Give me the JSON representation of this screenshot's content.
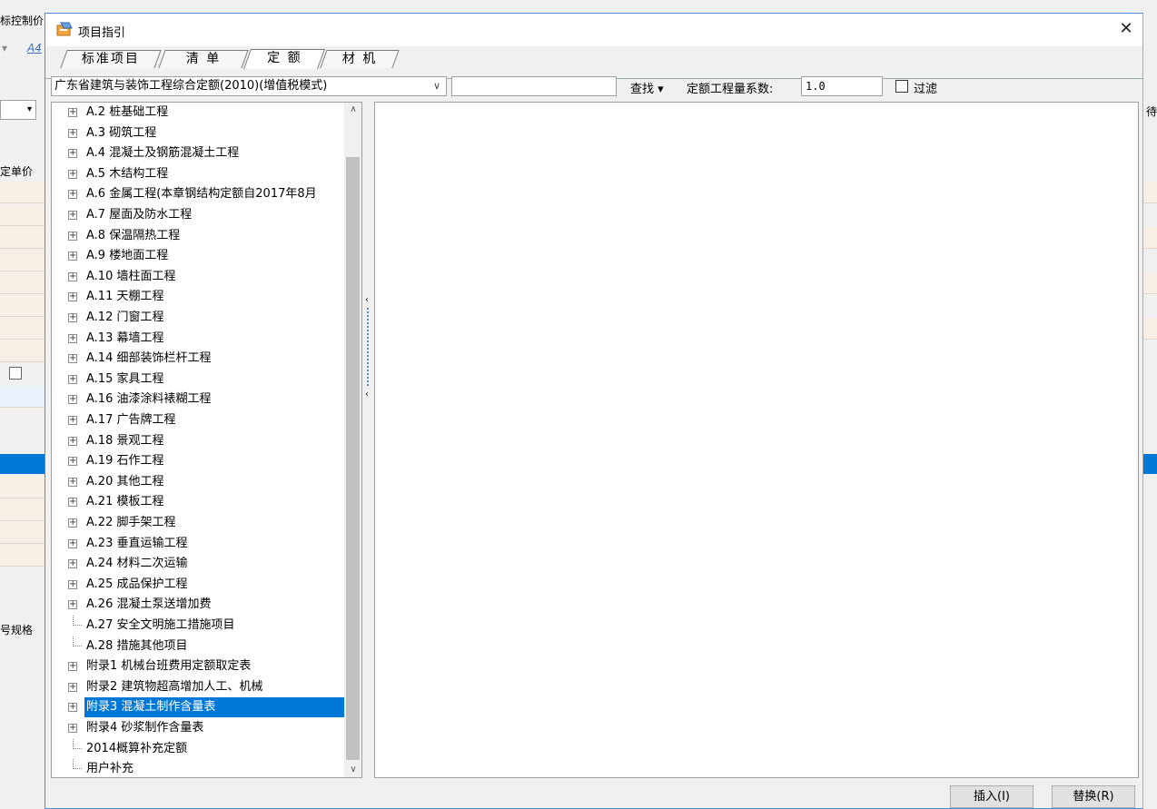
{
  "background": {
    "top_label": "标控制价",
    "price_header": "定单价",
    "spec_header": "号规格",
    "right_label": "待征",
    "font_icon": "A4"
  },
  "dialog": {
    "title": "项目指引",
    "close_label": "✕",
    "tabs": [
      {
        "label": "标准项目"
      },
      {
        "label": "清 单"
      },
      {
        "label": "定 额"
      },
      {
        "label": "材 机"
      }
    ],
    "quota_select": "广东省建筑与装饰工程综合定额(2010)(增值税模式)",
    "search_value": "",
    "find_label": "查找 ▾",
    "coef_label": "定额工程量系数:",
    "coef_value": "1.0",
    "filter_label": "过滤",
    "insert_label": "插入(I)",
    "replace_label": "替换(R)"
  },
  "tree": [
    {
      "label": "A.2 桩基础工程",
      "expandable": true
    },
    {
      "label": "A.3 砌筑工程",
      "expandable": true
    },
    {
      "label": "A.4 混凝土及钢筋混凝土工程",
      "expandable": true
    },
    {
      "label": "A.5 木结构工程",
      "expandable": true
    },
    {
      "label": "A.6 金属工程(本章钢结构定额自2017年8月",
      "expandable": true
    },
    {
      "label": "A.7 屋面及防水工程",
      "expandable": true
    },
    {
      "label": "A.8 保温隔热工程",
      "expandable": true
    },
    {
      "label": "A.9 楼地面工程",
      "expandable": true
    },
    {
      "label": "A.10 墙柱面工程",
      "expandable": true
    },
    {
      "label": "A.11 天棚工程",
      "expandable": true
    },
    {
      "label": "A.12 门窗工程",
      "expandable": true
    },
    {
      "label": "A.13 幕墙工程",
      "expandable": true
    },
    {
      "label": "A.14 细部装饰栏杆工程",
      "expandable": true
    },
    {
      "label": "A.15 家具工程",
      "expandable": true
    },
    {
      "label": "A.16 油漆涂料裱糊工程",
      "expandable": true
    },
    {
      "label": "A.17 广告牌工程",
      "expandable": true
    },
    {
      "label": "A.18 景观工程",
      "expandable": true
    },
    {
      "label": "A.19 石作工程",
      "expandable": true
    },
    {
      "label": "A.20 其他工程",
      "expandable": true
    },
    {
      "label": "A.21 模板工程",
      "expandable": true
    },
    {
      "label": "A.22 脚手架工程",
      "expandable": true
    },
    {
      "label": "A.23 垂直运输工程",
      "expandable": true
    },
    {
      "label": "A.24 材料二次运输",
      "expandable": true
    },
    {
      "label": "A.25 成品保护工程",
      "expandable": true
    },
    {
      "label": "A.26 混凝土泵送增加费",
      "expandable": true
    },
    {
      "label": "A.27 安全文明施工措施项目",
      "expandable": false
    },
    {
      "label": "A.28 措施其他项目",
      "expandable": false
    },
    {
      "label": "附录1 机械台班费用定额取定表",
      "expandable": true
    },
    {
      "label": "附录2 建筑物超高增加人工、机械",
      "expandable": true
    },
    {
      "label": "附录3 混凝土制作含量表",
      "expandable": true,
      "selected": true
    },
    {
      "label": "附录4 砂浆制作含量表",
      "expandable": true
    },
    {
      "label": "2014概算补充定额",
      "expandable": false
    },
    {
      "label": "用户补充",
      "expandable": false
    }
  ],
  "colors": {
    "selection": "#0078d7",
    "dialog_border": "#4a90d9"
  }
}
